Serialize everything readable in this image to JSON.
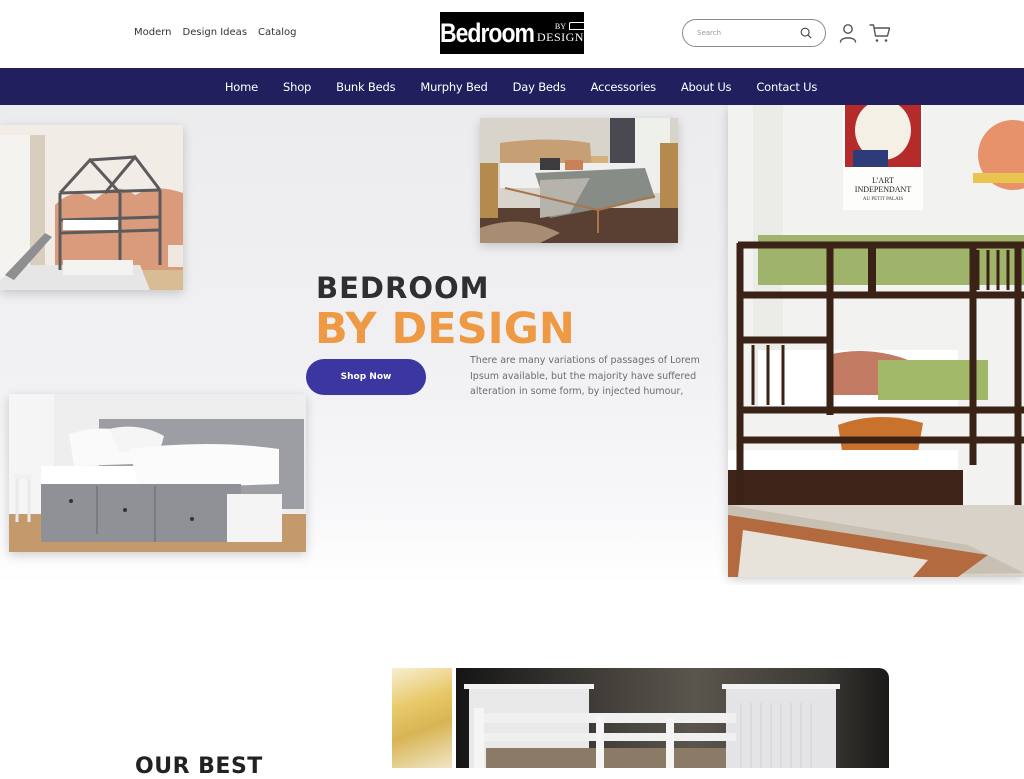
{
  "header": {
    "top_links": [
      "Modern",
      "Design Ideas",
      "Catalog"
    ],
    "logo": {
      "main": "Bedroom",
      "by": "BY",
      "design": "DESIGN"
    },
    "search": {
      "placeholder": "Search",
      "value": ""
    },
    "icons": {
      "search": "search-icon",
      "account": "user-icon",
      "cart": "cart-icon"
    }
  },
  "nav": {
    "items": [
      "Home",
      "Shop",
      "Bunk Beds",
      "Murphy Bed",
      "Day Beds",
      "Accessories",
      "About Us",
      "Contact Us"
    ]
  },
  "hero": {
    "title_line1": "BEDROOM",
    "title_line2": "BY DESIGN",
    "cta_label": "Shop Now",
    "description": "There are many variations of passages of Lorem Ipsum available, but the majority have suffered alteration in some form, by injected humour,",
    "images": [
      {
        "alt": "Gray house-frame loft bunk bed with slide"
      },
      {
        "alt": "Wooden platform bed in warm bedroom"
      },
      {
        "alt": "Gray daybed with three drawers"
      },
      {
        "alt": "Espresso bunk bed with trundle"
      }
    ],
    "poster_text": [
      "L'ART",
      "INDEPENDANT",
      "AU PETIT PALAIS"
    ]
  },
  "section_best": {
    "title": "OUR BEST"
  },
  "colors": {
    "nav_bg": "#221f5f",
    "accent_orange": "#ee9a45",
    "button_bg": "#3b36a0",
    "title_dark": "#2f2f33"
  }
}
